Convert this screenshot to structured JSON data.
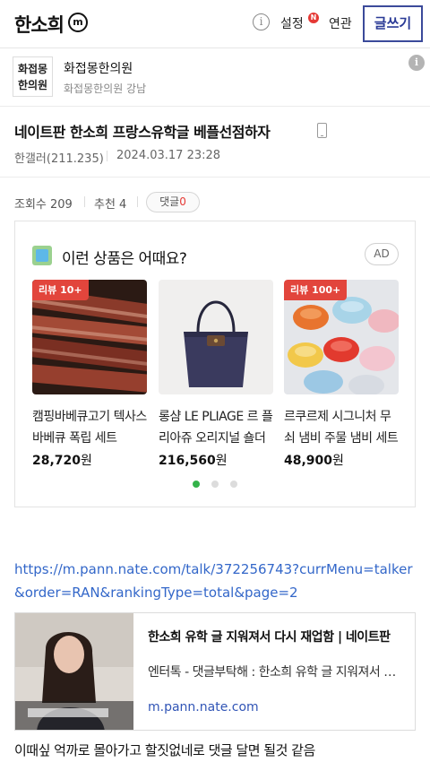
{
  "header": {
    "logo_text": "한소희",
    "logo_badge": "m",
    "info_icon": "i",
    "settings_label": "설정",
    "settings_badge": "N",
    "related_label": "연관",
    "write_label": "글쓰기"
  },
  "channel": {
    "logo_line1": "화접몽",
    "logo_line2": "한의원",
    "name": "화접몽한의원",
    "subtitle": "화접몽한의원 강남",
    "info_icon": "i"
  },
  "post": {
    "title": "네이트판 한소희 프랑스유학글 베플선점하자",
    "device_icon": "mobile-icon",
    "author": "한갤러(211.235)",
    "date": "2024.03.17 23:28",
    "views": "조회수 209",
    "recommends": "추천 4",
    "comment_label": "댓글",
    "comment_count": "0",
    "link": "https://m.pann.nate.com/talk/372256743?currMenu=talker&order=RAN&rankingType=total&page=2",
    "body": "이때싶 억까로 몰아가고 할짓없네로 댓글 달면 될것 같음"
  },
  "ad": {
    "title": "이런 상품은 어때요?",
    "badge": "AD",
    "products": [
      {
        "badge": "리뷰 10+",
        "name": "캠핑바베큐고기 텍사스바베큐 폭립 세트",
        "price": "28,720",
        "unit": "원"
      },
      {
        "badge": "",
        "name": "롱샴 LE PLIAGE 르 플리아쥬 오리지널 숄더백",
        "price": "216,560",
        "unit": "원"
      },
      {
        "badge": "리뷰 100+",
        "name": "르쿠르제 시그니처 무쇠 냄비 주물 냄비 세트",
        "price": "48,900",
        "unit": "원"
      }
    ],
    "dots_total": 3,
    "dots_active": 0,
    "active_color": "#34b24a"
  },
  "preview": {
    "title": "한소희 유학 글 지워져서 다시 재업함 | 네이트판",
    "desc": "엔터톡 - 댓글부탁해 : 한소희 유학 글 지워져서 다시 재업함",
    "domain": "m.pann.nate.com"
  },
  "colors": {
    "accent": "#2a3a96",
    "link": "#3367c9",
    "badge_red": "#e2453c"
  }
}
